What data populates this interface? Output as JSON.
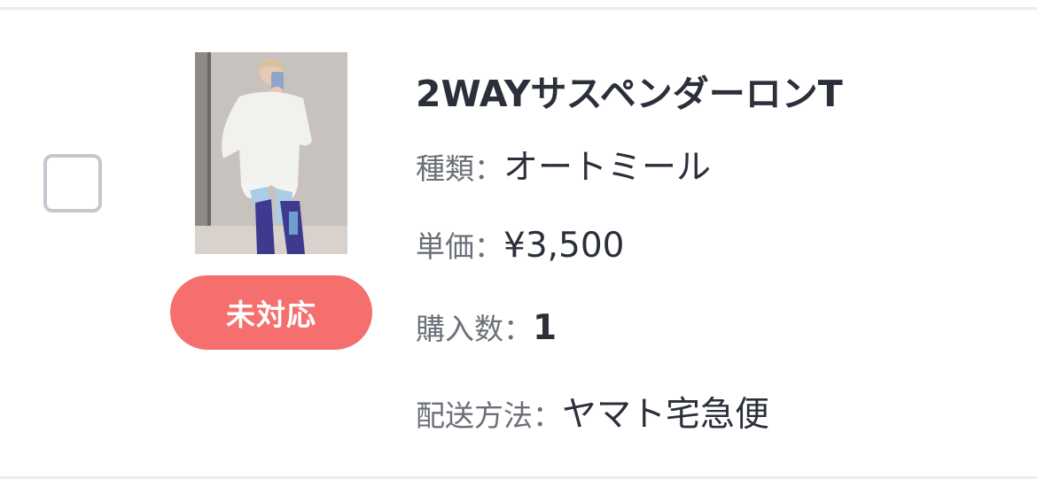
{
  "product": {
    "name": "2WAYサスペンダーロンT",
    "image_alt": "product photo",
    "status": "未対応",
    "status_color": "#f46f6d",
    "details": [
      {
        "label": "種類：",
        "value": "オートミール"
      },
      {
        "label": "単価：",
        "value": "¥3,500"
      },
      {
        "label": "購入数：",
        "value": "1"
      },
      {
        "label": "配送方法：",
        "value": "ヤマト宅急便"
      }
    ]
  }
}
